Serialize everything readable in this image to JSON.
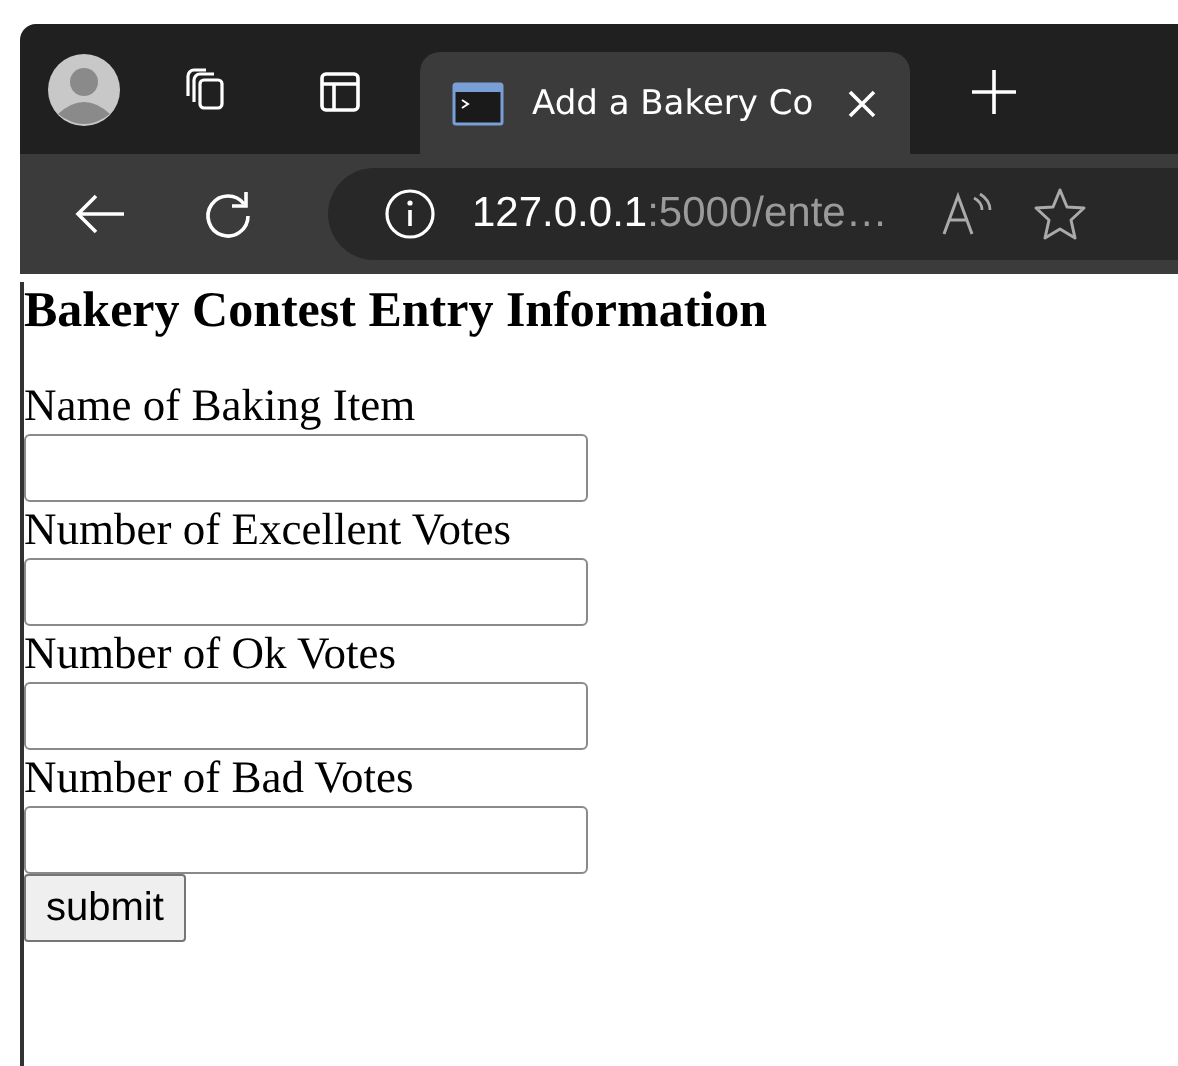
{
  "tabs": [
    {
      "label": "Add a Bakery Co",
      "selected": true
    }
  ],
  "address": {
    "host": "127.0.0.1",
    "path": ":5000/ente…"
  },
  "page": {
    "heading": "Bakery Contest Entry Information",
    "fields": [
      {
        "label": "Name of Baking Item"
      },
      {
        "label": "Number of Excellent Votes"
      },
      {
        "label": "Number of Ok Votes"
      },
      {
        "label": "Number of Bad Votes"
      }
    ],
    "submit": "submit"
  }
}
